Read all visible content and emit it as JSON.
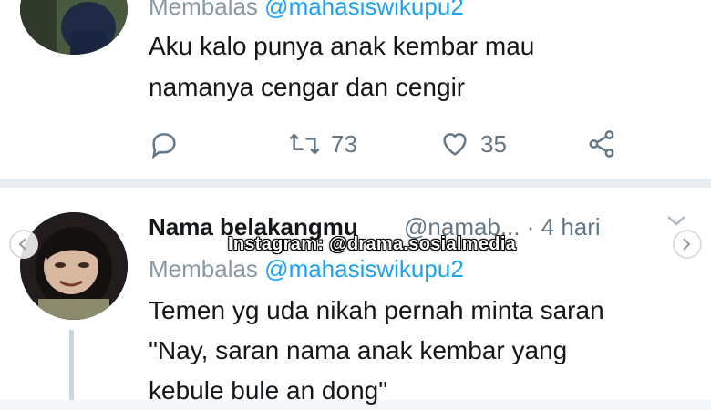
{
  "tweet1": {
    "reply_prefix": "Membalas",
    "reply_to": "@mahasiswikupu2",
    "text_line1": "Aku kalo punya anak kembar mau",
    "text_line2": "namanya cengar dan cengir",
    "replies_icon": "reply-icon",
    "retweet_count": "73",
    "like_count": "35",
    "share_icon": "share-icon"
  },
  "tweet2": {
    "display_name": "Nama belakangmu",
    "handle_time": "@namab... · 4 hari",
    "reply_prefix": "Membalas",
    "reply_to": "@mahasiswikupu2",
    "text_line1": "Temen yg uda nikah pernah minta saran",
    "text_line2": "\"Nay, saran nama anak kembar yang",
    "text_line3": "kebule bule an dong\""
  },
  "watermark": "Instagram: @drama.sosialmedia",
  "colors": {
    "link": "#1da1f2",
    "muted": "#657786",
    "text": "#14171a"
  }
}
